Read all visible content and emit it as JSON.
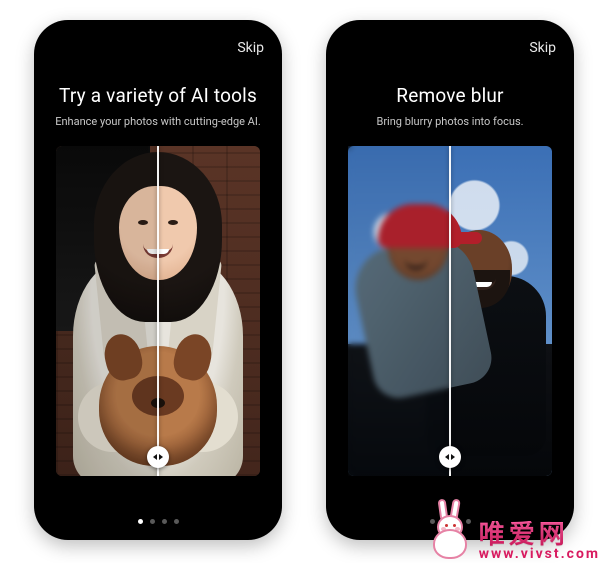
{
  "screens": [
    {
      "skip_label": "Skip",
      "title": "Try a variety of AI tools",
      "subtitle": "Enhance your photos with cutting-edge AI.",
      "page_index": 0,
      "page_count": 4
    },
    {
      "skip_label": "Skip",
      "title": "Remove blur",
      "subtitle": "Bring blurry photos into focus.",
      "page_index": 1,
      "page_count": 4
    }
  ],
  "watermark": {
    "site_name_cn": "唯爱网",
    "site_url": "www.vivst.com"
  }
}
